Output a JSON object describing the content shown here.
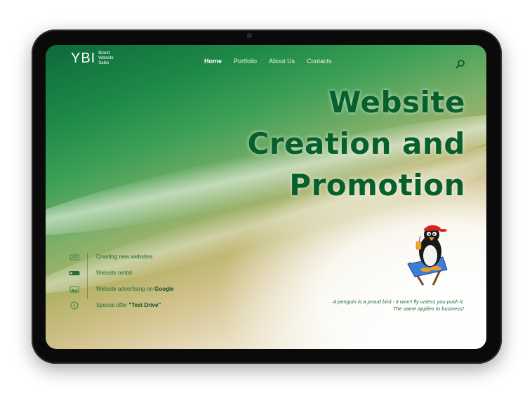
{
  "logo": {
    "mark": "YBI",
    "tagline": "Brand Website Sales"
  },
  "nav": {
    "items": [
      {
        "label": "Home",
        "active": true
      },
      {
        "label": "Portfolio",
        "active": false
      },
      {
        "label": "About Us",
        "active": false
      },
      {
        "label": "Contacts",
        "active": false
      }
    ],
    "search_icon": "search-icon"
  },
  "hero": {
    "line1": "Website",
    "line2": "Creation and",
    "line3": "Promotion"
  },
  "features": [
    {
      "icon": "website-creation-icon",
      "text": "Creating new websites",
      "bold": ""
    },
    {
      "icon": "rental-icon",
      "text": "Website rental",
      "bold": ""
    },
    {
      "icon": "advertising-icon",
      "text": "Website advertising on ",
      "bold": "Google"
    },
    {
      "icon": "offer-icon",
      "text": "Special offer ",
      "bold": "\"Test Drive\""
    }
  ],
  "quote": {
    "line1": "A penguin is a proud bird - it won't fly unless you push it.",
    "line2": "The same applies to business!"
  },
  "colors": {
    "hero_text": "#075f2c",
    "feature_text": "#1d6d37",
    "nav_text": "#e9f4d6",
    "tablet_frame": "#0a0a0a"
  }
}
